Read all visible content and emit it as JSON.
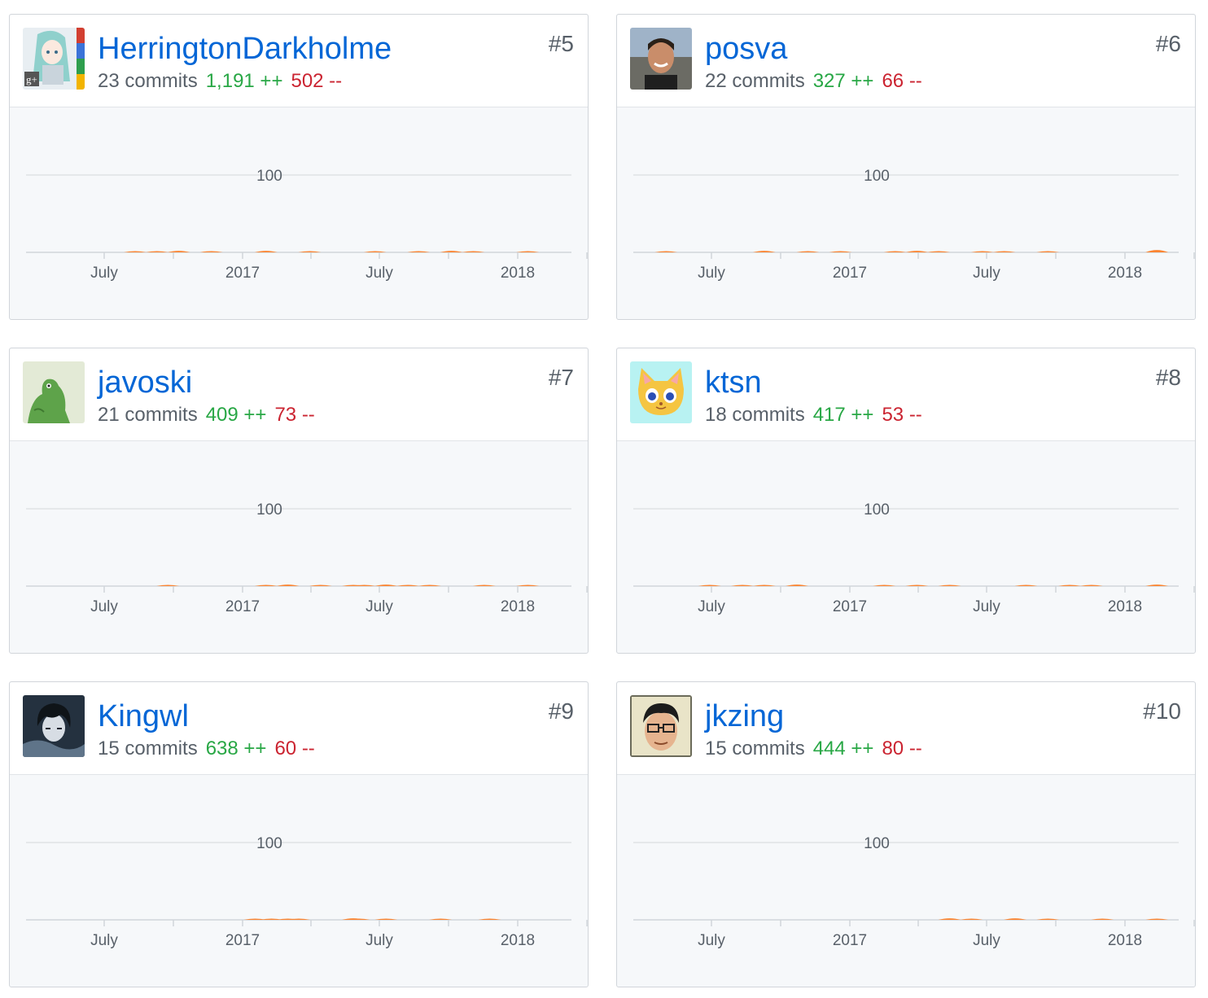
{
  "colors": {
    "link": "#0366d6",
    "additions": "#28a745",
    "deletions": "#cb2431",
    "commit_area": "#fb8532",
    "muted_text": "#586069"
  },
  "contributors": [
    {
      "rank": "#5",
      "username": "HerringtonDarkholme",
      "commits": "23 commits",
      "additions": "1,191 ++",
      "deletions": "502 --",
      "avatar_icon": "anime-avatar-icon",
      "chart_data": {
        "type": "area",
        "ytick": "100",
        "ylim": [
          0,
          100
        ],
        "xticks": [
          "July",
          "2017",
          "July",
          "2018"
        ],
        "x": [
          0.2,
          0.24,
          0.28,
          0.34,
          0.44,
          0.52,
          0.64,
          0.72,
          0.78,
          0.82,
          0.92
        ],
        "values": [
          1,
          1,
          2,
          1,
          2,
          1,
          1,
          1,
          2,
          1,
          1
        ]
      }
    },
    {
      "rank": "#6",
      "username": "posva",
      "commits": "22 commits",
      "additions": "327 ++",
      "deletions": "66 --",
      "avatar_icon": "photo-avatar-icon",
      "chart_data": {
        "type": "area",
        "ytick": "100",
        "ylim": [
          0,
          100
        ],
        "xticks": [
          "July",
          "2017",
          "July",
          "2018"
        ],
        "x": [
          0.06,
          0.24,
          0.32,
          0.38,
          0.48,
          0.52,
          0.56,
          0.64,
          0.68,
          0.76,
          0.96
        ],
        "values": [
          1,
          2,
          1,
          1,
          1,
          2,
          1,
          1,
          1,
          1,
          3
        ]
      }
    },
    {
      "rank": "#7",
      "username": "javoski",
      "commits": "21 commits",
      "additions": "409 ++",
      "deletions": "73 --",
      "avatar_icon": "frog-avatar-icon",
      "chart_data": {
        "type": "area",
        "ytick": "100",
        "ylim": [
          0,
          100
        ],
        "xticks": [
          "July",
          "2017",
          "July",
          "2018"
        ],
        "x": [
          0.26,
          0.44,
          0.48,
          0.54,
          0.6,
          0.62,
          0.66,
          0.7,
          0.74,
          0.84,
          0.92
        ],
        "values": [
          1,
          1,
          2,
          1,
          1,
          1,
          2,
          1,
          1,
          1,
          1
        ]
      }
    },
    {
      "rank": "#8",
      "username": "ktsn",
      "commits": "18 commits",
      "additions": "417 ++",
      "deletions": "53 --",
      "avatar_icon": "cat-avatar-icon",
      "chart_data": {
        "type": "area",
        "ytick": "100",
        "ylim": [
          0,
          100
        ],
        "xticks": [
          "July",
          "2017",
          "July",
          "2018"
        ],
        "x": [
          0.14,
          0.2,
          0.24,
          0.3,
          0.46,
          0.52,
          0.58,
          0.72,
          0.8,
          0.84,
          0.96
        ],
        "values": [
          1,
          1,
          1,
          2,
          1,
          1,
          1,
          1,
          1,
          1,
          2
        ]
      }
    },
    {
      "rank": "#9",
      "username": "Kingwl",
      "commits": "15 commits",
      "additions": "638 ++",
      "deletions": "60 --",
      "avatar_icon": "dark-hair-avatar-icon",
      "chart_data": {
        "type": "area",
        "ytick": "100",
        "ylim": [
          0,
          100
        ],
        "xticks": [
          "July",
          "2017",
          "July",
          "2018"
        ],
        "x": [
          0.42,
          0.45,
          0.48,
          0.5,
          0.6,
          0.61,
          0.66,
          0.76,
          0.85
        ],
        "values": [
          1,
          1,
          1,
          1,
          2,
          1,
          1,
          1,
          1
        ]
      }
    },
    {
      "rank": "#10",
      "username": "jkzing",
      "commits": "15 commits",
      "additions": "444 ++",
      "deletions": "80 --",
      "avatar_icon": "glasses-avatar-icon",
      "chart_data": {
        "type": "area",
        "ytick": "100",
        "ylim": [
          0,
          100
        ],
        "xticks": [
          "July",
          "2017",
          "July",
          "2018"
        ],
        "x": [
          0.58,
          0.62,
          0.7,
          0.76,
          0.86,
          0.96
        ],
        "values": [
          2,
          1,
          2,
          1,
          1,
          1
        ]
      }
    }
  ]
}
